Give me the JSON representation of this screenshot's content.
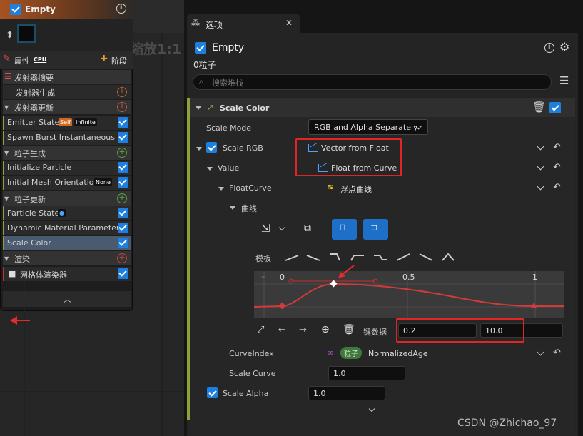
{
  "graph": {
    "zoom_label": "缩放1:1"
  },
  "node": {
    "title": "Empty",
    "tab_properties": "属性",
    "tab_cpu": "CPU",
    "tab_stage": "阶段",
    "rows": [
      {
        "label": "发射器摘要",
        "kind": "sec"
      },
      {
        "label": "发射器生成",
        "kind": "sub"
      },
      {
        "label": "发射器更新",
        "kind": "sec"
      },
      {
        "label": "Emitter State",
        "kind": "item",
        "badges": [
          "Self",
          "Infinite"
        ]
      },
      {
        "label": "Spawn Burst Instantaneous",
        "kind": "item"
      },
      {
        "label": "粒子生成",
        "kind": "sec"
      },
      {
        "label": "Initialize Particle",
        "kind": "item"
      },
      {
        "label": "Initial Mesh Orientation",
        "kind": "item",
        "badges": [
          "None"
        ]
      },
      {
        "label": "粒子更新",
        "kind": "sec"
      },
      {
        "label": "Particle State",
        "kind": "item"
      },
      {
        "label": "Dynamic Material Parameters",
        "kind": "item"
      },
      {
        "label": "Scale Color",
        "kind": "item",
        "selected": true
      },
      {
        "label": "渲染",
        "kind": "sec"
      },
      {
        "label": "网格体渲染器",
        "kind": "item"
      }
    ]
  },
  "panel": {
    "tab_label": "选项",
    "emitter_name": "Empty",
    "particle_count": "0粒子",
    "search_placeholder": "搜索堆栈",
    "module_title": "Scale Color",
    "scale_mode_label": "Scale Mode",
    "scale_mode_value": "RGB and Alpha Separately",
    "scale_rgb_label": "Scale RGB",
    "scale_rgb_value": "Vector from Float",
    "value_label": "Value",
    "value_value": "Float from Curve",
    "float_curve_label": "FloatCurve",
    "float_curve_value": "浮点曲线",
    "curve_label": "曲线",
    "template_label": "模板",
    "curve_axis": [
      "0",
      "0.5",
      "1"
    ],
    "key_data_label": "键数据",
    "key_time": "0.2",
    "key_value": "10.0",
    "curve_index_label": "CurveIndex",
    "curve_index_badge": "粒子",
    "curve_index_value": "NormalizedAge",
    "scale_curve_label": "Scale Curve",
    "scale_curve_value": "1.0",
    "scale_alpha_label": "Scale Alpha",
    "scale_alpha_value": "1.0"
  },
  "watermark": "CSDN @Zhichao_97",
  "colors": {
    "accent": "#1d7fe0",
    "highlight": "#e12424",
    "curve": "#d33a3a",
    "module_stripe": "#8ca33a"
  }
}
